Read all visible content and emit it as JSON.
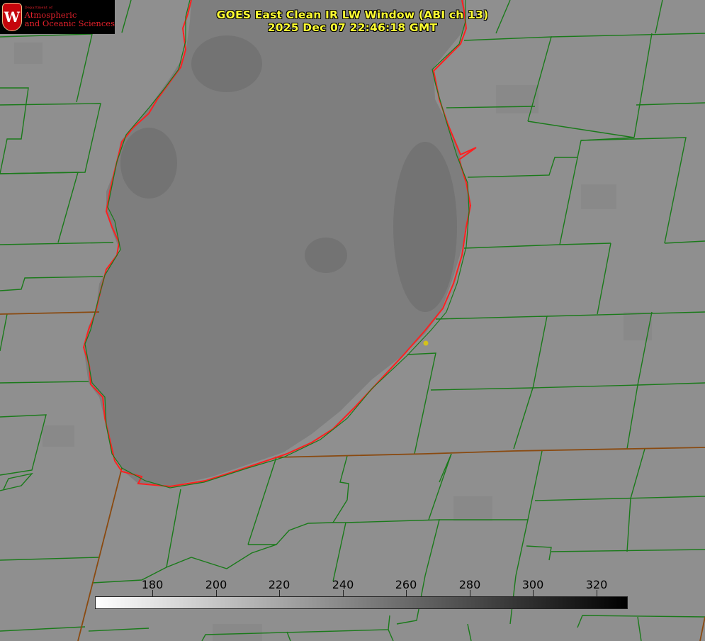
{
  "header": {
    "title_line1": "GOES East Clean IR LW Window (ABI ch 13)",
    "title_line2": "2025 Dec 07 22:46:18 GMT"
  },
  "logo": {
    "department": "Department of",
    "line1": "Atmospheric",
    "line2": "and Oceanic Sciences",
    "emblem": "W"
  },
  "colorbar": {
    "ticks": [
      "180",
      "200",
      "220",
      "240",
      "260",
      "280",
      "300",
      "320"
    ],
    "gradient": [
      "#ffffff",
      "#000000"
    ]
  },
  "colors": {
    "land": "#8f8f8f",
    "lake": "#7c7c7c",
    "county_lines": "#1a7a1a",
    "state_lines": "#8a4a10",
    "coastline": "#ff2020",
    "title_text": "#ffff33",
    "marker": "#d4c21a"
  },
  "icons": {
    "logo_emblem": "uw-crest-icon",
    "station_marker": "yellow-dot-icon"
  }
}
